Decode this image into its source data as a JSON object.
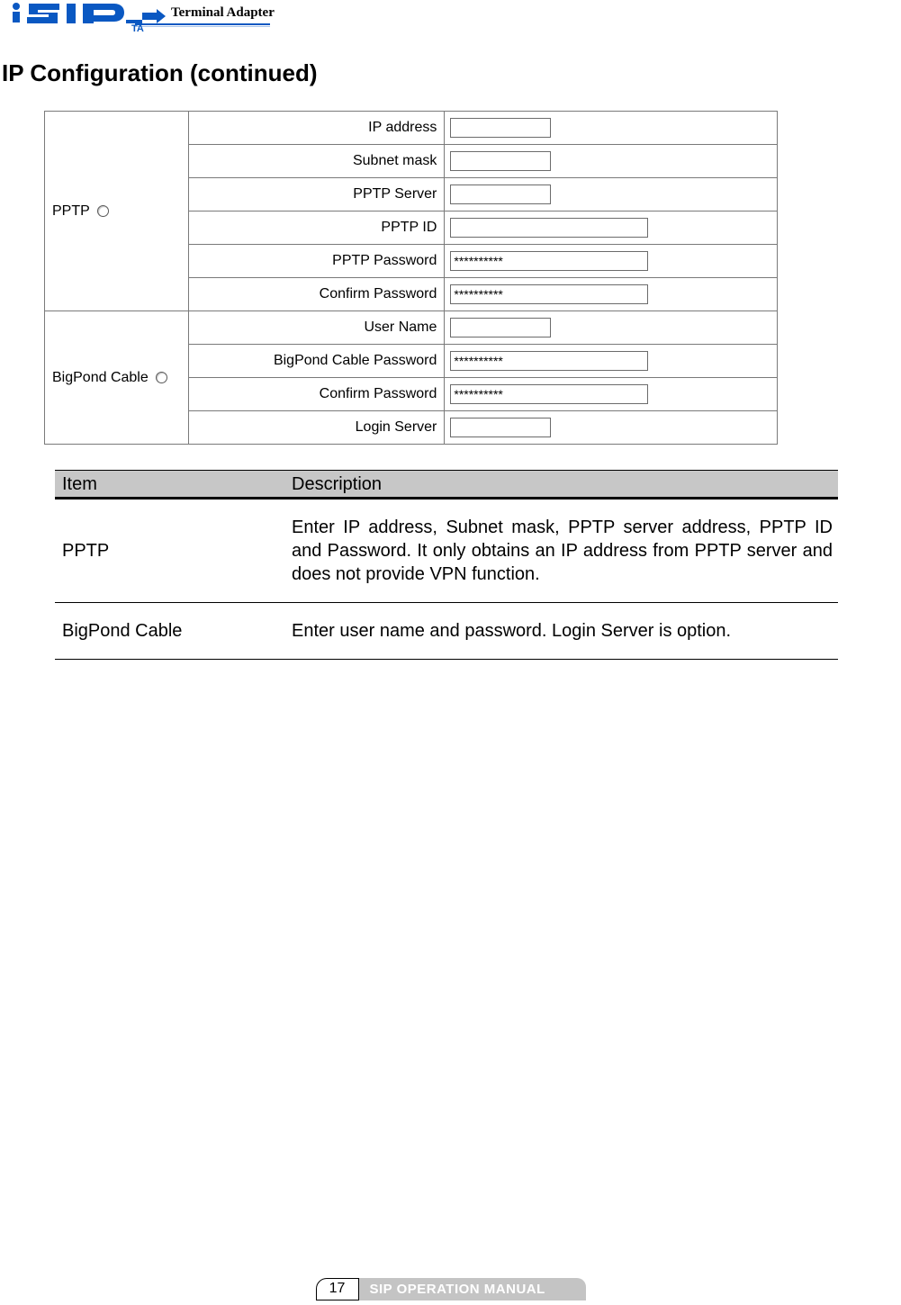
{
  "brand": {
    "product_line": "Terminal Adapter",
    "logo_alt": "SIP TA"
  },
  "heading": "IP Configuration (continued)",
  "screenshot": {
    "groups": [
      {
        "name": "PPTP",
        "radio_selected": false,
        "rows": [
          {
            "label": "IP address",
            "value": "",
            "password": false,
            "narrow": true
          },
          {
            "label": "Subnet mask",
            "value": "",
            "password": false,
            "narrow": true
          },
          {
            "label": "PPTP Server",
            "value": "",
            "password": false,
            "narrow": true
          },
          {
            "label": "PPTP ID",
            "value": "",
            "password": false,
            "narrow": false
          },
          {
            "label": "PPTP Password",
            "value": "**********",
            "password": true,
            "narrow": false
          },
          {
            "label": "Confirm Password",
            "value": "**********",
            "password": true,
            "narrow": false
          }
        ]
      },
      {
        "name": "BigPond Cable",
        "radio_selected": false,
        "rows": [
          {
            "label": "User Name",
            "value": "",
            "password": false,
            "narrow": true
          },
          {
            "label": "BigPond Cable Password",
            "value": "**********",
            "password": true,
            "narrow": false
          },
          {
            "label": "Confirm Password",
            "value": "**********",
            "password": true,
            "narrow": false
          },
          {
            "label": "Login Server",
            "value": "",
            "password": false,
            "narrow": true
          }
        ]
      }
    ]
  },
  "descTable": {
    "headers": {
      "item": "Item",
      "description": "Description"
    },
    "rows": [
      {
        "item": "PPTP",
        "description": "Enter IP address, Subnet mask, PPTP server address, PPTP ID and Password. It only obtains an IP address from PPTP server and does not provide VPN function."
      },
      {
        "item": "BigPond Cable",
        "description": "Enter user name and password. Login Server is option."
      }
    ]
  },
  "footer": {
    "page_number": "17",
    "label": "SIP OPERATION MANUAL"
  }
}
